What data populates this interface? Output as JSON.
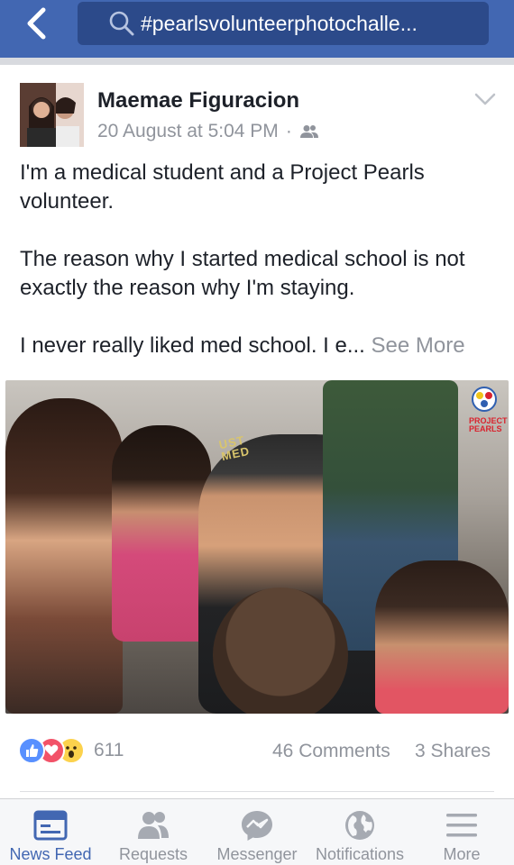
{
  "search": {
    "query": "#pearlsvolunteerphotochalle..."
  },
  "post": {
    "author": "Maemae Figuracion",
    "timestamp": "20 August at 5:04 PM",
    "separator": "·",
    "privacy_icon": "friends-icon",
    "paragraphs": [
      "I'm a medical student and a Project Pearls volunteer.",
      "The reason why I started medical school is not exactly the reason why I'm staying.",
      "I never really liked med school. I e..."
    ],
    "see_more": "See More",
    "photo": {
      "logo_text_1": "PROJECT",
      "logo_text_2": "PEARLS",
      "cap_text_1": "UST",
      "cap_text_2": "MED"
    },
    "reaction_count": "611",
    "comments": "46 Comments",
    "shares": "3 Shares"
  },
  "nav": {
    "items": [
      {
        "label": "News Feed",
        "icon": "news-feed-icon",
        "active": true
      },
      {
        "label": "Requests",
        "icon": "friend-requests-icon",
        "active": false
      },
      {
        "label": "Messenger",
        "icon": "messenger-icon",
        "active": false
      },
      {
        "label": "Notifications",
        "icon": "globe-icon",
        "active": false
      },
      {
        "label": "More",
        "icon": "menu-icon",
        "active": false
      }
    ]
  },
  "colors": {
    "brand": "#4267b2",
    "search_bg": "#2c4a8a",
    "muted": "#90949c",
    "like": "#5890ff",
    "love": "#f25268",
    "wow": "#fcd24d"
  }
}
